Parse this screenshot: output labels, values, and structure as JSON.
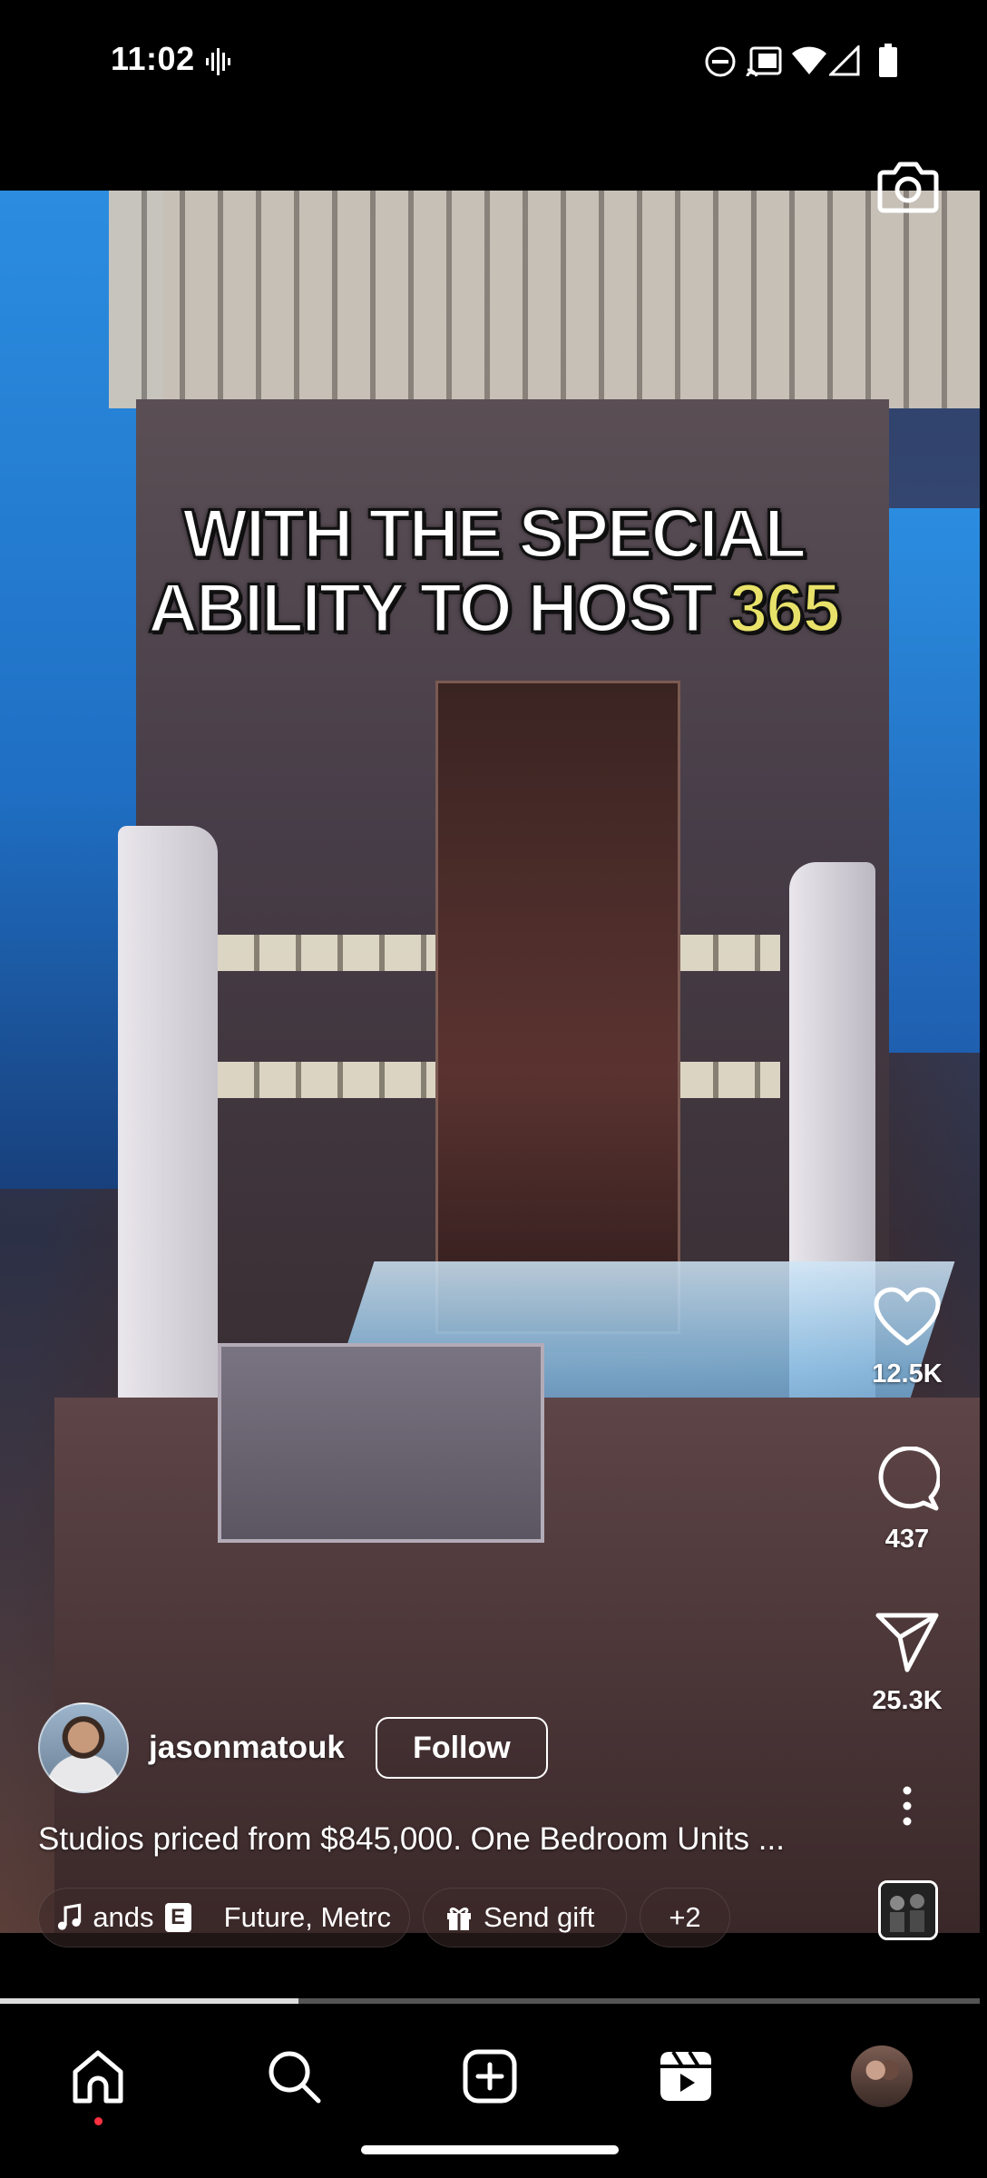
{
  "status_bar": {
    "time": "11:02",
    "icons": [
      "voice-wave-icon",
      "do-not-disturb-icon",
      "cast-icon",
      "wifi-icon",
      "signal-icon",
      "battery-icon"
    ]
  },
  "video": {
    "caption_overlay": {
      "line1": "WITH THE SPECIAL",
      "line2_text": "ABILITY TO HOST ",
      "line2_highlight": "365"
    },
    "highlight_color": "#e9e26a",
    "progress": 0.305
  },
  "actions": {
    "likes": "12.5K",
    "comments": "437",
    "shares": "25.3K"
  },
  "post": {
    "username": "jasonmatouk",
    "follow_label": "Follow",
    "caption": "Studios priced from $845,000. One Bedroom Units ...",
    "music_chip": {
      "song_fragment": "ands",
      "explicit_badge": "E",
      "artist": "Future, Metrc"
    },
    "gift_label": "Send gift",
    "more_label": "+2"
  },
  "nav": {
    "items": [
      "home-icon",
      "search-icon",
      "create-icon",
      "reels-icon",
      "profile-avatar"
    ],
    "active": "reels"
  }
}
